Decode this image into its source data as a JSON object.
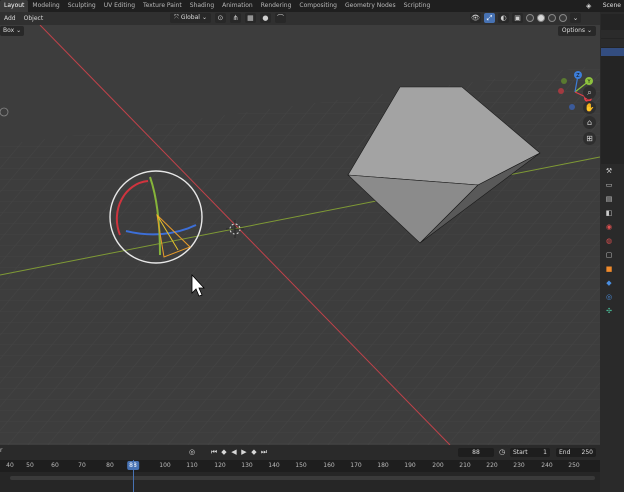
{
  "workspace_tabs": [
    "Layout",
    "Modeling",
    "Sculpting",
    "UV Editing",
    "Texture Paint",
    "Shading",
    "Animation",
    "Rendering",
    "Compositing",
    "Geometry Nodes",
    "Scripting"
  ],
  "active_tab": "Layout",
  "scene": {
    "label": "Scene"
  },
  "header": {
    "menus": [
      "Add",
      "Object"
    ],
    "orientation": "Global",
    "select_mode": "Box",
    "options_label": "Options"
  },
  "gizmo_axes": {
    "x": "X",
    "y": "Y",
    "z": "Z"
  },
  "timeline": {
    "label": "r",
    "current_frame": "88",
    "start_label": "Start",
    "start": "1",
    "end_label": "End",
    "end": "250",
    "ticks": [
      "40",
      "50",
      "60",
      "70",
      "80",
      "88",
      "100",
      "110",
      "120",
      "130",
      "140",
      "150",
      "160",
      "170",
      "180",
      "190",
      "200",
      "210",
      "220",
      "230",
      "240",
      "250"
    ]
  },
  "icons": {
    "gizmo_zoom": "zoom-icon",
    "gizmo_pan": "hand-icon",
    "camera_view": "camera-icon",
    "grid_view": "grid-icon"
  },
  "colors": {
    "accent": "#4772b3",
    "axis_x": "#e0404a",
    "axis_y": "#8dc13e",
    "axis_z": "#3d7dd8",
    "viewport_bg": "#3d3d3d"
  }
}
